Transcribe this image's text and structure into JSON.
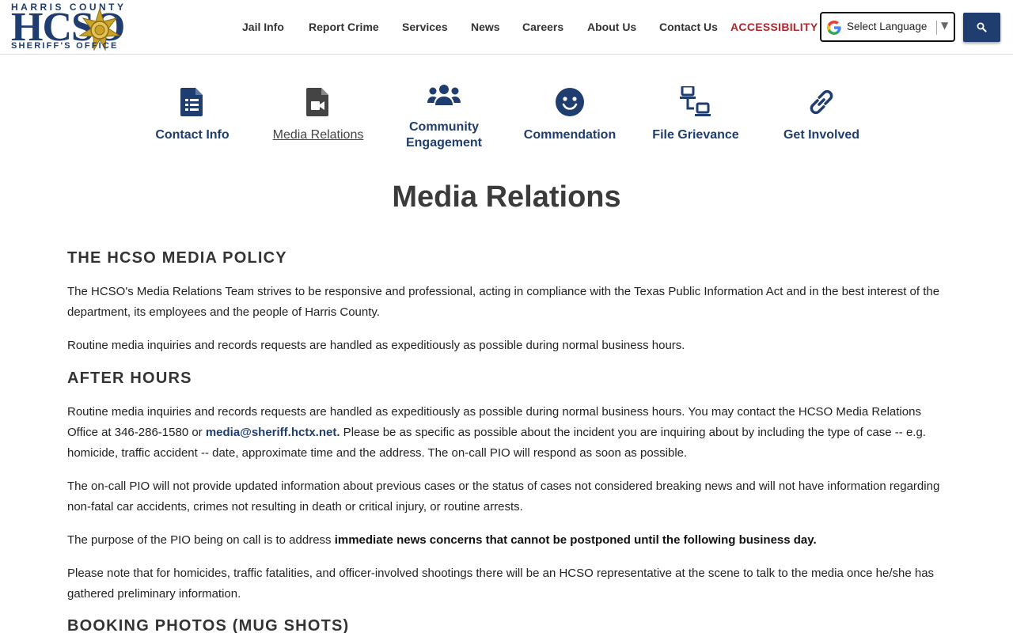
{
  "header": {
    "logo": {
      "top_text": "HARRIS COUNTY",
      "big_text": "HCSO",
      "bottom_text": "SHERIFF'S OFFICE"
    },
    "nav": [
      {
        "label": "Jail Info"
      },
      {
        "label": "Report Crime"
      },
      {
        "label": "Services"
      },
      {
        "label": "News"
      },
      {
        "label": "Careers"
      },
      {
        "label": "About Us"
      },
      {
        "label": "Contact Us"
      },
      {
        "label": "ACCESSIBILITY"
      }
    ],
    "language": {
      "label": "Select Language"
    },
    "search_icon": "search-icon"
  },
  "quick_links": [
    {
      "label": "Contact Info",
      "icon": "document-list-icon"
    },
    {
      "label": "Media Relations",
      "icon": "video-file-icon",
      "active": true
    },
    {
      "label": "Community Engagement",
      "icon": "users-icon"
    },
    {
      "label": "Commendation",
      "icon": "smile-icon"
    },
    {
      "label": "File Grievance",
      "icon": "network-icon"
    },
    {
      "label": "Get Involved",
      "icon": "link-icon"
    }
  ],
  "main": {
    "title": "Media Relations",
    "sections": [
      {
        "heading": "THE HCSO MEDIA POLICY"
      },
      {
        "heading": "AFTER HOURS"
      },
      {
        "heading": "BOOKING PHOTOS (MUG SHOTS)"
      }
    ],
    "policy_p1": "The HCSO's Media Relations Team strives to be responsive and professional, acting in compliance with the Texas Public Information Act and in the best interest of the department, its employees and the people of Harris County.",
    "policy_p2": "Routine media inquiries and records requests are handled as expeditiously as possible during normal business hours.",
    "after_p1_a": "Routine media inquiries and records requests are handled as expeditiously as possible during normal business hours. You may contact the HCSO Media Relations Office at 346-286-1580 or ",
    "after_p1_link": "media@sheriff.hctx.net.",
    "after_p1_b": " Please be as specific as possible about the incident you are inquiring about by including the type of case -- e.g. homicide, traffic accident -- date, approximate time and the address. The on-call PIO will respond as soon as possible.",
    "after_p2": "The on-call PIO will not provide updated information about previous cases or the status of cases not considered breaking news and will not have information regarding non-fatal car accidents, crimes not resulting in death or critical injury, or routine arrests.",
    "after_p3_a": "The purpose of the PIO being on call is to address ",
    "after_p3_bold": "immediate news concerns that cannot be postponed until the following business day.",
    "after_p4": "Please note that for homicides, traffic fatalities, and officer-involved shootings there will be an HCSO representative at the scene to talk to the media once he/she has gathered preliminary information."
  },
  "colors": {
    "brand_navy": "#1f3d6e",
    "accessibility_red": "#b0272d",
    "gold": "#c9a227"
  }
}
